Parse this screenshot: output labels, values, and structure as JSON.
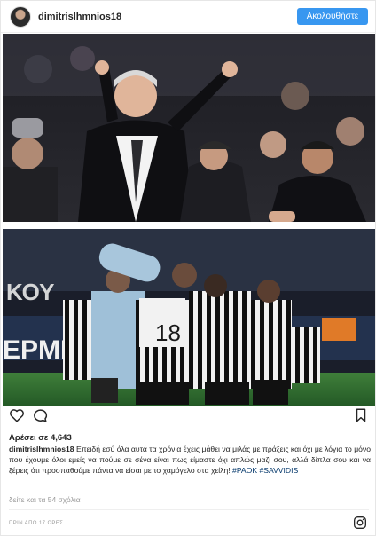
{
  "post": {
    "username": "dimitrislhmnios18",
    "follow_label": "Ακολουθήστε",
    "likes_label": "Αρέσει σε 4,643",
    "caption_user": "dimitrislhmnios18",
    "caption_text": "Επειδή εσύ όλα αυτά τα χρόνια έχεις μάθει να μιλάς με πράξεις και όχι με λόγια το μόνο που έχουμε όλοι εμείς να πούμε σε σένα είναι πως είμαστε όχι απλώς μαζί σου, αλλά δίπλα σου και να ξέρεις ότι προσπαθούμε πάντα να είσαι με το χαμόγελο στα χείλη!",
    "hashtag_1": "#PAOK",
    "hashtag_2": "#SAVVIDIS",
    "comments_link": "δείτε και τα 54 σχόλια",
    "timestamp": "ΠΡΙΝ ΑΠΟ 17 ΩΡΕΣ"
  },
  "photo": {
    "jersey_number": "18",
    "stadium_letters_left": "ΚΟΥ",
    "stadium_letters_bottom": "ΕΡΜΙ"
  },
  "icons": {
    "avatar": "profile-avatar",
    "like": "heart-icon",
    "comment": "comment-bubble-icon",
    "save": "bookmark-icon",
    "brand": "instagram-glyph-icon"
  },
  "colors": {
    "follow_button": "#3897f0",
    "hashtag": "#003569",
    "muted_text": "#999999",
    "pitch": "#2e6b2f"
  }
}
